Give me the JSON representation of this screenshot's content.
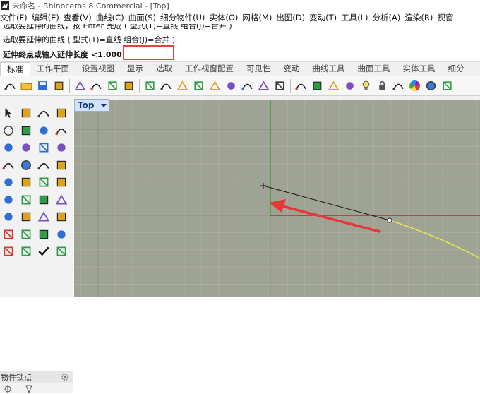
{
  "window": {
    "title": "未命名 - Rhinoceros 8 Commercial - [Top]"
  },
  "menu": [
    "文件(F)",
    "编辑(E)",
    "查看(V)",
    "曲线(C)",
    "曲面(S)",
    "细分物件(U)",
    "实体(O)",
    "网格(M)",
    "出图(D)",
    "变动(T)",
    "工具(L)",
    "分析(A)",
    "渲染(R)",
    "视窗"
  ],
  "command": {
    "history_1": "选取要延伸的曲线，按 Enter 完成 ( 型式(T)=直线  组合(J)=合并 )",
    "history_2": "选取要延伸的曲线 ( 型式(T)=直线  组合(J)=合并 )",
    "prompt": "延伸终点或输入延伸长度 <1.000>",
    "input_value": ""
  },
  "tabs": [
    {
      "label": "标准",
      "active": true
    },
    {
      "label": "工作平面"
    },
    {
      "label": "设置视图"
    },
    {
      "label": "显示"
    },
    {
      "label": "选取"
    },
    {
      "label": "工作视窗配置"
    },
    {
      "label": "可见性"
    },
    {
      "label": "变动"
    },
    {
      "label": "曲线工具"
    },
    {
      "label": "曲面工具"
    },
    {
      "label": "实体工具"
    },
    {
      "label": "细分"
    }
  ],
  "toolbar": [
    "new-file-icon",
    "open-folder-icon",
    "save-icon",
    "print-icon",
    "export-icon",
    "cut-icon",
    "copy-icon",
    "paste-icon",
    "undo-icon",
    "pan-hand-icon",
    "rotate-view-icon",
    "zoom-icon",
    "zoom-window-icon",
    "zoom-extents-icon",
    "zoom-selected-icon",
    "rotate-icon",
    "four-viewports-icon",
    "car-icon",
    "grid-plane-icon",
    "snap-target-icon",
    "gear-options-icon",
    "light-bulb-icon",
    "lock-icon",
    "material-icon",
    "color-wheel-icon",
    "render-sphere-icon",
    "help-icon"
  ],
  "sidebar": {
    "tools": [
      "select-arrow-icon",
      "point-icon",
      "polyline-icon",
      "curve-icon",
      "circle-icon",
      "arc-center-icon",
      "ellipse-icon",
      "arc-icon",
      "polygon-icon",
      "fillet-curve-icon",
      "surface-from-curves-icon",
      "surface-edit-icon",
      "box-icon",
      "sphere-icon",
      "cylinder-icon",
      "plane-icon",
      "explode-icon",
      "flash-icon",
      "trim-icon",
      "split-icon",
      "boolean-icon",
      "dots-icon",
      "curve-tool-icon",
      "offset-icon",
      "extrude-icon",
      "array-icon",
      "mirror-icon",
      "scale-icon",
      "solid-box-icon",
      "text-icon",
      "grid-array-icon",
      "cabinet-icon",
      "dimension-icon",
      "bolt-icon",
      "check-icon",
      "mesh-icon"
    ],
    "osnap_title": "物件锁点"
  },
  "viewport": {
    "name": "Top",
    "label_text": "Top"
  },
  "colors": {
    "viewport_bg": "#9fa394",
    "grid_minor": "#aeb1a4",
    "grid_major": "#8a8d80",
    "y_axis": "#2e9e2e",
    "x_axis": "#a33434",
    "line": "#1a1a1a",
    "curve": "#e8e84a",
    "arrow": "#e6383a",
    "highlight_box": "#e8403a"
  }
}
